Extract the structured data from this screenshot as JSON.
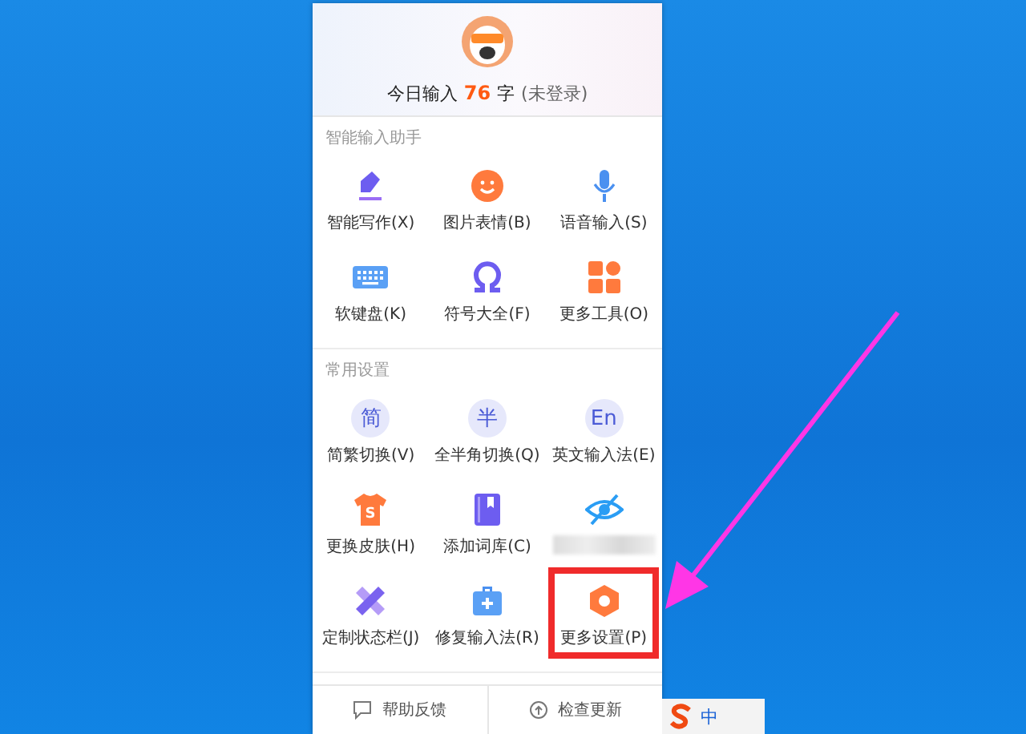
{
  "header": {
    "prefix": "今日输入",
    "count": "76",
    "suffix": "字",
    "login_status": "(未登录)"
  },
  "sections": [
    {
      "title": "智能输入助手",
      "items": [
        {
          "kind": "pen",
          "label": "智能写作(X)",
          "highlighted": false
        },
        {
          "kind": "smile",
          "label": "图片表情(B)",
          "highlighted": false
        },
        {
          "kind": "mic",
          "label": "语音输入(S)",
          "highlighted": false
        },
        {
          "kind": "keyboard",
          "label": "软键盘(K)",
          "highlighted": false
        },
        {
          "kind": "omega",
          "label": "符号大全(F)",
          "highlighted": false
        },
        {
          "kind": "tiles",
          "label": "更多工具(O)",
          "highlighted": false
        }
      ]
    },
    {
      "title": "常用设置",
      "items": [
        {
          "kind": "glyph",
          "glyph": "简",
          "label": "简繁切换(V)",
          "highlighted": false
        },
        {
          "kind": "glyph",
          "glyph": "半",
          "label": "全半角切换(Q)",
          "highlighted": false
        },
        {
          "kind": "glyph",
          "glyph": "En",
          "label": "英文输入法(E)",
          "highlighted": false
        },
        {
          "kind": "shirt",
          "glyph": "S",
          "label": "更换皮肤(H)",
          "highlighted": false
        },
        {
          "kind": "book",
          "label": "添加词库(C)",
          "highlighted": false
        },
        {
          "kind": "eye",
          "highlighted": false
        },
        {
          "kind": "ruler",
          "label": "定制状态栏(J)",
          "highlighted": false
        },
        {
          "kind": "toolbox",
          "label": "修复输入法(R)",
          "highlighted": false
        },
        {
          "kind": "hexagon",
          "label": "更多设置(P)",
          "highlighted": true
        }
      ]
    }
  ],
  "footer": [
    {
      "kind": "chat",
      "label": "帮助反馈"
    },
    {
      "kind": "up",
      "label": "检查更新"
    }
  ],
  "taskbar": {
    "ime_mode": "中"
  }
}
